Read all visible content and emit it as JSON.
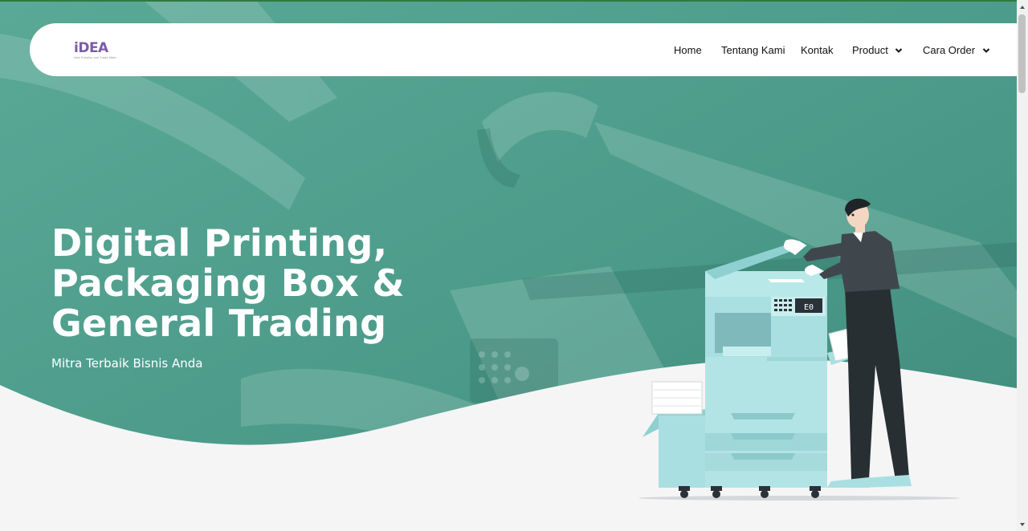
{
  "brand": {
    "logo_text": "iDEA",
    "tagline": "Idea Solution and Trade Mark"
  },
  "nav": {
    "home": "Home",
    "about": "Tentang Kami",
    "contact": "Kontak",
    "product": "Product",
    "order": "Cara Order"
  },
  "hero": {
    "headline_line1": "Digital Printing,",
    "headline_line2": "Packaging Box &",
    "headline_line3": "General Trading",
    "subtitle": "Mitra Terbaik Bisnis Anda",
    "copier_display": "E0"
  },
  "icons": {
    "product_dropdown": "chevron-down-icon",
    "order_dropdown": "chevron-down-icon",
    "scroll_up": "triangle-up-icon",
    "scroll_down": "triangle-down-icon"
  },
  "colors": {
    "hero_overlay": "#4e9e8d",
    "wave_background": "#f5f5f6",
    "logo_purple": "#7a5ca8",
    "copier_teal": "#a9dfe0"
  }
}
